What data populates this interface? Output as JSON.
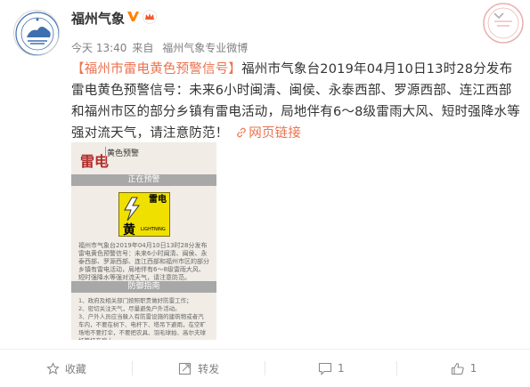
{
  "post": {
    "author": "福州气象",
    "time": "今天 13:40",
    "via_prefix": "来自",
    "source": "福州气象专业微博",
    "hashtag": "【福州市雷电黄色预警信号】",
    "body": "福州市气象台2019年04月10日13时28分发布雷电黄色预警信号：未来6小时闽清、闽侯、永泰西部、罗源西部、连江西部和福州市区的部分乡镇有雷电活动，局地伴有6～8级雷雨大风、短时强降水等强对流天气，请注意防范！",
    "web_link": "网页链接",
    "stamp_text": "福州气象"
  },
  "warning_image": {
    "title": "雷电",
    "subtitle": "黄色预警",
    "band_active": "正在预警",
    "sign_top": "雷电",
    "sign_char": "黄",
    "sign_en": "LIGHTNING",
    "desc": "福州市气象台2019年04月10日13时28分发布雷电黄色预警信号：未来6小时闽清、闽侯、永泰西部、罗源西部、连江西部和福州市区的部分乡镇有雷电活动，局地伴有6～8级雷雨大风、短时强降水等强对流天气，请注意防范。",
    "band_guide": "防御指南",
    "guide": "1、政府及相关部门按照职责做好防雷工作；\n2、密切关注天气，尽量避免户外活动。\n3、户外人员应当躲入有防雷设施的建筑物或者汽车内，不要在树下、电杆下、塔吊下避雨，在空旷场地不要打伞，不要把农具、羽毛球拍、高尔夫球杆等扛在肩上。"
  },
  "actions": {
    "favorite": "收藏",
    "repost": "转发",
    "comments": "1",
    "likes": "1"
  },
  "colors": {
    "accent": "#eb7350",
    "warning_red": "#b22a2a",
    "warning_yellow": "#f0e000"
  }
}
